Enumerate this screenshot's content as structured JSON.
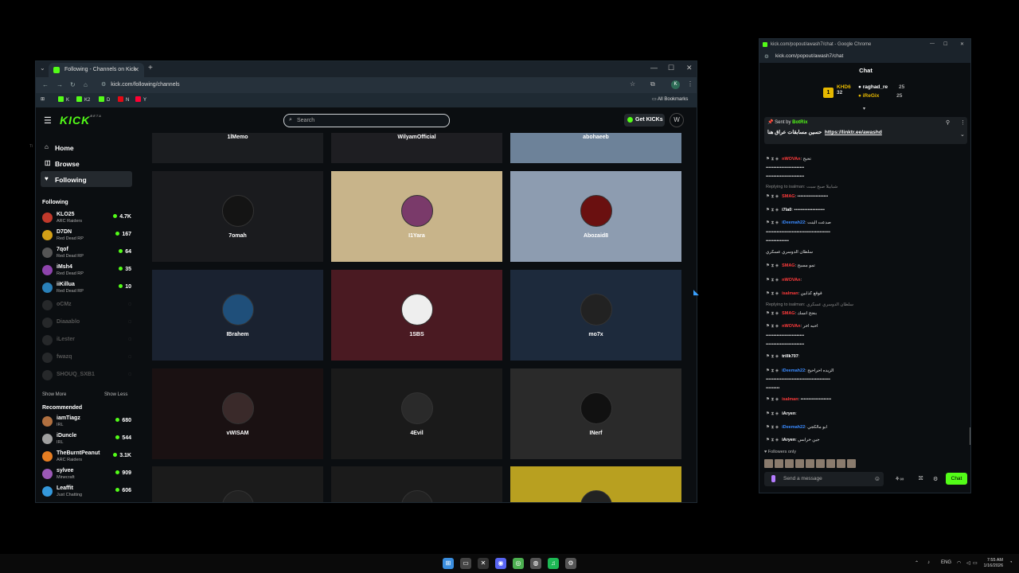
{
  "browser": {
    "tab_title": "Following - Channels on Kick",
    "url": "kick.com/following/channels",
    "profile_initial": "K",
    "bookmarks": [
      {
        "label": "K",
        "color": "#53fc18"
      },
      {
        "label": "K2",
        "color": "#53fc18"
      },
      {
        "label": "D",
        "color": "#53fc18"
      },
      {
        "label": "N",
        "color": "#e50914"
      },
      {
        "label": "Y",
        "color": "#ff0033"
      }
    ],
    "all_bookmarks": "All Bookmarks"
  },
  "kick": {
    "logo": "KICK",
    "logo_sup": "BETA",
    "search_placeholder": "Search",
    "get_kicks": "Get KICKs",
    "user_initial": "W",
    "accent": "#53fc18"
  },
  "sidebar": {
    "nav": [
      {
        "label": "Home",
        "icon": "⌂"
      },
      {
        "label": "Browse",
        "icon": "◫"
      },
      {
        "label": "Following",
        "icon": "♥"
      }
    ],
    "following_title": "Following",
    "following": [
      {
        "name": "KLO25",
        "game": "ARC Raiders",
        "viewers": "4.7K",
        "color": "#c0392b",
        "live": true
      },
      {
        "name": "D7DN",
        "game": "Red Dead RP",
        "viewers": "167",
        "color": "#d4a017",
        "live": true
      },
      {
        "name": "7qof",
        "game": "Red Dead RP",
        "viewers": "64",
        "color": "#555",
        "live": true
      },
      {
        "name": "iMsh4",
        "game": "Red Dead RP",
        "viewers": "35",
        "color": "#8e44ad",
        "live": true
      },
      {
        "name": "iiKillua",
        "game": "Red Dead RP",
        "viewers": "10",
        "color": "#2980b9",
        "live": true
      },
      {
        "name": "oCMz",
        "game": "",
        "viewers": "",
        "color": "#666",
        "live": false
      },
      {
        "name": "Diaaablo",
        "game": "",
        "viewers": "",
        "color": "#666",
        "live": false
      },
      {
        "name": "iLester",
        "game": "",
        "viewers": "",
        "color": "#666",
        "live": false
      },
      {
        "name": "fwazq",
        "game": "",
        "viewers": "",
        "color": "#666",
        "live": false
      },
      {
        "name": "SHOUQ_SXB1",
        "game": "",
        "viewers": "",
        "color": "#666",
        "live": false
      }
    ],
    "show_more": "Show More",
    "show_less": "Show Less",
    "recommended_title": "Recommended",
    "recommended": [
      {
        "name": "iamTiagz",
        "game": "IRL",
        "viewers": "680",
        "color": "#b07040"
      },
      {
        "name": "iDuncle",
        "game": "IRL",
        "viewers": "544",
        "color": "#a0a0a0"
      },
      {
        "name": "TheBurntPeanut",
        "game": "ARC Raiders",
        "viewers": "3.1K",
        "color": "#e67e22"
      },
      {
        "name": "sylvee",
        "game": "Minecraft",
        "viewers": "909",
        "color": "#9b59b6"
      },
      {
        "name": "Leaffit",
        "game": "Just Chatting",
        "viewers": "606",
        "color": "#3498db"
      }
    ]
  },
  "channels": [
    {
      "name": "1lMemo",
      "bg": "#1b1d20",
      "avatar": "#111"
    },
    {
      "name": "WilyamOfficial",
      "bg": "#1e1e22",
      "avatar": "#111"
    },
    {
      "name": "abohaeeb",
      "bg": "#6d8299",
      "avatar": "#333"
    },
    {
      "name": "7omah",
      "bg": "#1a1b1e",
      "avatar": "#141414"
    },
    {
      "name": "I1Yara",
      "bg": "#c8b48a",
      "avatar": "#7a3a6a"
    },
    {
      "name": "Abozaid8",
      "bg": "#8d9cb0",
      "avatar": "#6a1010"
    },
    {
      "name": "IBrahem",
      "bg": "#1a2230",
      "avatar": "#1f4f7a"
    },
    {
      "name": "1SBS",
      "bg": "#4a1a22",
      "avatar": "#eee"
    },
    {
      "name": "mo7x",
      "bg": "#1d2a3c",
      "avatar": "#222"
    },
    {
      "name": "vWISAM",
      "bg": "#1a1112",
      "avatar": "#3a2a2a"
    },
    {
      "name": "4Evil",
      "bg": "#1a1a1a",
      "avatar": "#2a2a2a"
    },
    {
      "name": "INerf",
      "bg": "#2a2a2a",
      "avatar": "#111"
    },
    {
      "name": "",
      "bg": "#1b1b1b",
      "avatar": "#222"
    },
    {
      "name": "",
      "bg": "#1b1b1b",
      "avatar": "#222"
    },
    {
      "name": "",
      "bg": "#b8a020",
      "avatar": "#222"
    }
  ],
  "chat": {
    "window_title": "kick.com/popout/awash7/chat - Google Chrome",
    "url": "kick.com/popout/awash7/chat",
    "heading": "Chat",
    "leaderboard": [
      {
        "name": "KHD6",
        "value": "32",
        "color": "#e6b800"
      },
      {
        "name": "raghad_re",
        "value": "25",
        "color": "#fff"
      },
      {
        "name": "iReGix",
        "value": "25",
        "color": "#e6b800"
      }
    ],
    "pinned_by": "Sent by",
    "pinned_user": "BotRix",
    "pinned_text": "حسين مسابقات عراق هنا",
    "pinned_link": "https://linktr.ee/awashd",
    "messages": [
      {
        "user": "nWOVAn",
        "color": "#ff3b3b",
        "text": "تحيح"
      },
      {
        "user": "",
        "color": "#fff",
        "text": "•••••••••••••••••••••••••"
      },
      {
        "user": "",
        "color": "#fff",
        "text": "•••••••••••••••••••••••••"
      },
      {
        "user": "",
        "color": "#888",
        "text": "Replying to isalman: شبابيلا صبح سبت",
        "reply": true
      },
      {
        "user": "SMAG",
        "color": "#ff3b3b",
        "text": "••••••••••••••••••••"
      },
      {
        "user": "i7la0",
        "color": "#fff",
        "text": "••••••••••••••••••••"
      },
      {
        "user": "iDeemah22",
        "color": "#3b8bff",
        "text": "صدعت البنت"
      },
      {
        "user": "",
        "color": "#fff",
        "text": "••••••••••••••••••••••••••••••••••••••••••"
      },
      {
        "user": "",
        "color": "#fff",
        "text": "•••••••••••••••"
      },
      {
        "user": "",
        "color": "#fff",
        "text": "سلطان الدوسري عسكري"
      },
      {
        "user": "SMAG",
        "color": "#ff3b3b",
        "text": "تمو مسيح"
      },
      {
        "user": "nWOVAn",
        "color": "#ff3b3b",
        "text": ""
      },
      {
        "user": "isalman",
        "color": "#ff3b3b",
        "text": "قوقع كذابين"
      },
      {
        "user": "",
        "color": "#888",
        "text": "Replying to isalman: سلطان الدوسري عسكري",
        "reply": true
      },
      {
        "user": "SMAG",
        "color": "#ff3b3b",
        "text": "بنجح انسك"
      },
      {
        "user": "nWOVAn",
        "color": "#ff3b3b",
        "text": "احبه اخر"
      },
      {
        "user": "",
        "color": "#fff",
        "text": "•••••••••••••••••••••••••"
      },
      {
        "user": "",
        "color": "#fff",
        "text": "•••••••••••••••••••••••••"
      },
      {
        "user": "trillk707",
        "color": "#fff",
        "text": ""
      },
      {
        "user": "iDeemah22",
        "color": "#3b8bff",
        "text": "الزيده احراحيح"
      },
      {
        "user": "",
        "color": "#fff",
        "text": "••••••••••••••••••••••••••••••••••••••••••"
      },
      {
        "user": "",
        "color": "#fff",
        "text": "•••••••••"
      },
      {
        "user": "isalman",
        "color": "#ff3b3b",
        "text": "••••••••••••••••••••"
      },
      {
        "user": "iAryen",
        "color": "#fff",
        "text": ""
      },
      {
        "user": "iDeemah22",
        "color": "#3b8bff",
        "text": "ابو مالكجي"
      },
      {
        "user": "iAryen",
        "color": "#fff",
        "text": "جين خرابس"
      }
    ],
    "followers_only": "Followers only",
    "input_placeholder": "Send a message",
    "send_label": "Chat"
  },
  "taskbar": {
    "apps": [
      {
        "icon": "windows-icon",
        "glyph": "⊞",
        "color": "#3a8dde"
      },
      {
        "icon": "files-icon",
        "glyph": "▭",
        "color": "#444"
      },
      {
        "icon": "xbox-icon",
        "glyph": "✕",
        "color": "#333"
      },
      {
        "icon": "discord-icon",
        "glyph": "◉",
        "color": "#5865f2"
      },
      {
        "icon": "chrome-icon",
        "glyph": "◎",
        "color": "#4caf50"
      },
      {
        "icon": "github-icon",
        "glyph": "◍",
        "color": "#555"
      },
      {
        "icon": "spotify-icon",
        "glyph": "♫",
        "color": "#1db954"
      },
      {
        "icon": "settings-icon",
        "glyph": "⚙",
        "color": "#555"
      }
    ],
    "lang": "ENG",
    "time": "7:55 AM",
    "date": "1/16/2026"
  }
}
